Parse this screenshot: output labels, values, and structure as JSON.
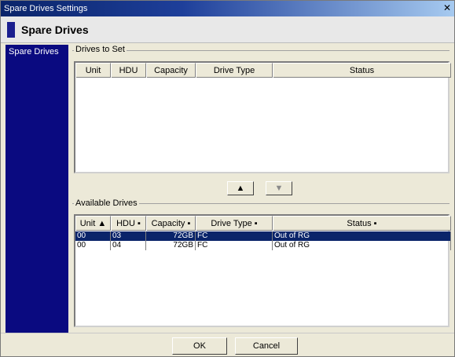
{
  "window": {
    "title": "Spare Drives Settings"
  },
  "header": {
    "title": "Spare Drives"
  },
  "sidebar": {
    "items": [
      {
        "label": "Spare Drives"
      }
    ]
  },
  "drives_to_set": {
    "title": "Drives to Set",
    "columns": [
      "Unit",
      "HDU",
      "Capacity",
      "Drive Type",
      "Status"
    ],
    "rows": []
  },
  "move": {
    "up_label": "▲",
    "down_label": "▼"
  },
  "available": {
    "title": "Available Drives",
    "columns": [
      "Unit ▲",
      "HDU ▪",
      "Capacity ▪",
      "Drive Type ▪",
      "Status ▪"
    ],
    "rows": [
      {
        "unit": "00",
        "hdu": "03",
        "capacity": "72GB",
        "type": "FC",
        "status": "Out of RG",
        "selected": true
      },
      {
        "unit": "00",
        "hdu": "04",
        "capacity": "72GB",
        "type": "FC",
        "status": "Out of RG",
        "selected": false
      }
    ]
  },
  "footer": {
    "ok_label": "OK",
    "cancel_label": "Cancel"
  },
  "colors": {
    "sidebar": "#0a0a80",
    "selection": "#0a246a",
    "title_bar": "#0a246a"
  }
}
